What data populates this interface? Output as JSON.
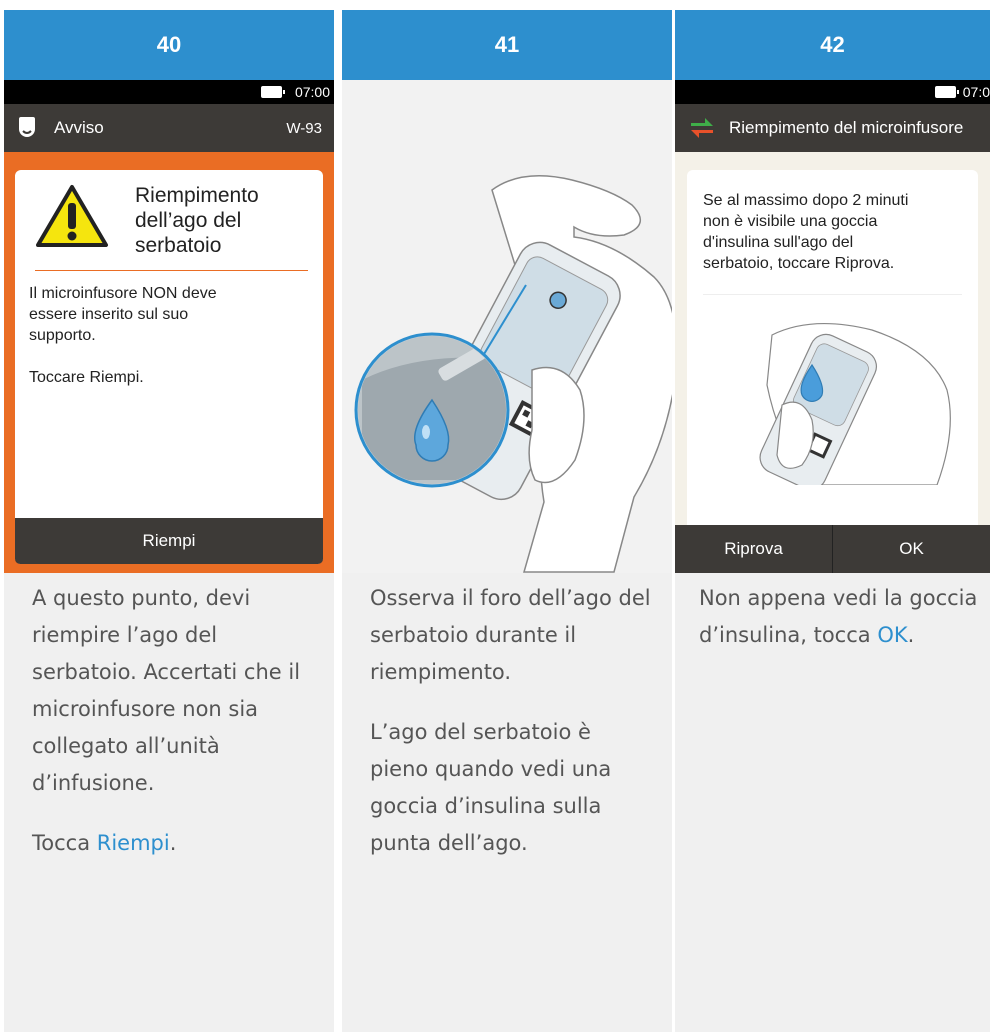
{
  "steps": [
    {
      "number": "40",
      "screen": {
        "time": "07:00",
        "title": "Avviso",
        "code": "W-93",
        "card_title": "Riempimento\ndell’ago del\nserbatoio",
        "card_message": "Il microinfusore NON deve\nessere inserito sul suo\nsupporto.\n\nToccare Riempi.",
        "button": "Riempi"
      },
      "description": [
        "A questo punto, devi riempire l’ago del serbatoio. Accertati che il microinfusore non sia collegato all’unità d’infusione."
      ],
      "action_prefix": "Tocca ",
      "action_link": "Riempi",
      "action_suffix": "."
    },
    {
      "number": "41",
      "description": [
        "Osserva il foro dell’ago del serbatoio durante il riempimento.",
        "L’ago del serbatoio è pieno quando vedi una goccia d’insulina sulla punta dell’ago."
      ]
    },
    {
      "number": "42",
      "screen": {
        "time": "07:0",
        "title": "Riempimento del microinfusore",
        "card_message": "Se al massimo dopo 2 minuti\nnon è visibile una goccia\nd'insulina sull'ago del\nserbatoio, toccare Riprova.",
        "button_left": "Riprova",
        "button_right": "OK"
      },
      "action_prefix": "Non appena vedi la goccia d’insulina, tocca ",
      "action_link": "OK",
      "action_suffix": "."
    }
  ],
  "colors": {
    "header_blue": "#2d8fce",
    "alert_orange": "#ea6d24",
    "dark_bar": "#3d3a37",
    "warning_yellow": "#f5e50e"
  }
}
